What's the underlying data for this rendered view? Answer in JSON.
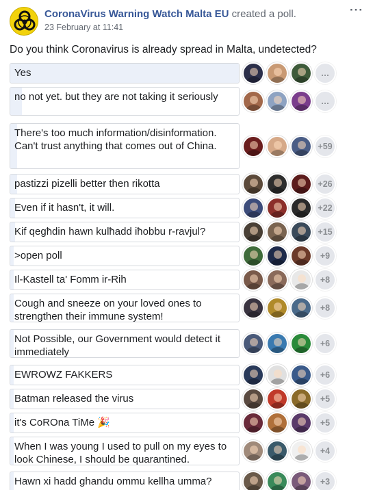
{
  "post": {
    "page_name": "CoronaVirus Warning Watch Malta EU",
    "action": "created a poll.",
    "timestamp": "23 February at 11:41",
    "more_icon": "···",
    "avatar_icon": "biohazard-icon",
    "avatar_colors": {
      "bg": "#f2d20c",
      "symbol": "#111111"
    }
  },
  "poll": {
    "question": "Do you think Coronavirus is already spread in Malta, undetected?",
    "options": [
      {
        "label": "Yes",
        "more": "…",
        "fill": 1.0,
        "voters": [
          "#2c2f4a",
          "#c99a74",
          "#3e5b3a"
        ]
      },
      {
        "label": "no not yet. but they are not taking it seriously",
        "more": "…",
        "fill": 0.05,
        "voters": [
          "#a2684a",
          "#8ea3c2",
          "#7a3d8c"
        ]
      },
      {
        "label": "There's too much information/disinformation. Can't trust anything that comes out of China.",
        "more": "+59",
        "fill": 0.03,
        "voters": [
          "#6b1e1e",
          "#d6a988",
          "#4a5d86"
        ]
      },
      {
        "label": "pastizzi pizelli better then rikotta",
        "more": "+26",
        "fill": 0.03,
        "voters": [
          "#5c4a3a",
          "#2e2e2e",
          "#5c1c1c"
        ]
      },
      {
        "label": "Even if it hasn't, it will.",
        "more": "+22",
        "fill": 0.02,
        "voters": [
          "#3d4c7a",
          "#8c2f2a",
          "#2a2a2a"
        ]
      },
      {
        "label": "Kif qegħdin hawn kulħadd iħobbu r-ravjul?",
        "more": "+15",
        "fill": 0.02,
        "voters": [
          "#4a4036",
          "#7a6450",
          "#3a4a5a"
        ]
      },
      {
        "label": ">open poll",
        "more": "+9",
        "fill": 0.015,
        "voters": [
          "#3f6b3a",
          "#1e2a4a",
          "#6b3a2a"
        ]
      },
      {
        "label": "Il-Kastell ta' Fomm ir-Rih",
        "more": "+8",
        "fill": 0.015,
        "voters": [
          "#7a5a4a",
          "#8a6a5a",
          "#e8e8e8"
        ]
      },
      {
        "label": "Cough and sneeze on your loved ones to strengthen their immune system!",
        "more": "+8",
        "fill": 0.015,
        "voters": [
          "#3a3440",
          "#b08a2a",
          "#4a6a8a"
        ]
      },
      {
        "label": "Not Possible, our Government would detect it immediately",
        "more": "+6",
        "fill": 0.012,
        "voters": [
          "#4a5a7a",
          "#3a7ab0",
          "#2a8a3a"
        ]
      },
      {
        "label": "EWROWZ FAKKERS",
        "more": "+6",
        "fill": 0.012,
        "voters": [
          "#2a3a5a",
          "#e0e0e0",
          "#3a5a8a"
        ]
      },
      {
        "label": "Batman released the virus",
        "more": "+5",
        "fill": 0.01,
        "voters": [
          "#5a4a40",
          "#c03a2a",
          "#8a6a2a"
        ]
      },
      {
        "label": "it's CoROna TiMe 🎉",
        "more": "+5",
        "fill": 0.01,
        "voters": [
          "#6a2a3a",
          "#b0703a",
          "#5a3a6a"
        ]
      },
      {
        "label": "When I was young I used to pull on my eyes to look Chinese, I should be quarantined.",
        "more": "+4",
        "fill": 0.01,
        "voters": [
          "#a08a7a",
          "#3a5a6a",
          "#f0f0f0"
        ]
      },
      {
        "label": "Hawn xi hadd ghandu ommu kellha umma?",
        "more": "+3",
        "fill": 0.008,
        "voters": [
          "#6a5a4a",
          "#3a8a5a",
          "#7a5a7a"
        ]
      }
    ]
  }
}
